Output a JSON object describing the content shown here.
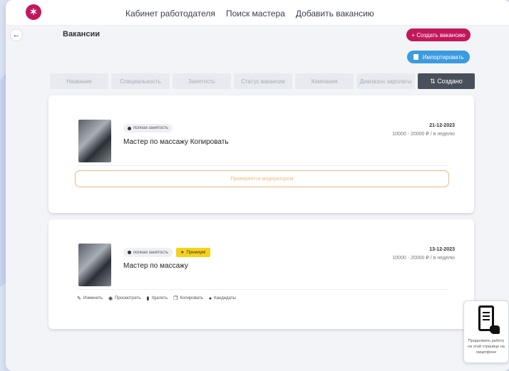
{
  "nav": {
    "items": [
      "Кабинет работодателя",
      "Поиск мастера",
      "Добавить вакансию"
    ]
  },
  "page": {
    "title": "Вакансии"
  },
  "buttons": {
    "create": "+ Создать вакансию",
    "import": "Импортировать"
  },
  "filters": [
    {
      "label": "Название",
      "active": false
    },
    {
      "label": "Специальность",
      "active": false
    },
    {
      "label": "Занятость",
      "active": false
    },
    {
      "label": "Статус вакансии",
      "active": false
    },
    {
      "label": "Компания",
      "active": false
    },
    {
      "label": "Диапазон зарплаты",
      "active": false
    },
    {
      "label": "Создано",
      "active": true,
      "icon": "sort-icon"
    }
  ],
  "vacancies": [
    {
      "employment": "полная занятость",
      "title": "Мастер по массажу Копировать",
      "date": "21-12-2023",
      "price": "10000 - 20000 ₽ / в неделю",
      "status": "Проверяется модератором"
    },
    {
      "employment": "полная занятость",
      "premium": "Премиум!",
      "title": "Мастер по массажу",
      "date": "13-12-2023",
      "price": "10000 - 20000 ₽ / в неделю",
      "actions": [
        "Изменить",
        "Просмотреть",
        "Удалить",
        "Копировать",
        "Кандидаты"
      ]
    }
  ],
  "widget": {
    "text": "Продолжить работу на этой странице на смартфоне"
  },
  "colors": {
    "brand": "#c2185b",
    "import": "#3b9be0",
    "moderation": "#f1b97d",
    "premium": "#f7d21a",
    "active_filter": "#4a4f5c"
  }
}
